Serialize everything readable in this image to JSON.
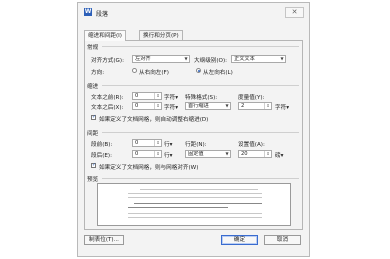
{
  "dialog": {
    "title": "段落",
    "app_icon": "W",
    "close_glyph": "✕",
    "tabs": [
      {
        "label": "缩进和间距(I)",
        "active": true
      },
      {
        "label": "换行和分页(P)",
        "active": false
      }
    ]
  },
  "general": {
    "heading": "常规",
    "alignment_label": "对齐方式(G):",
    "alignment_value": "左对齐",
    "outline_label": "大纲级别(O):",
    "outline_value": "正文文本",
    "direction_label": "方向:",
    "rtl_label": "从右向左(F)",
    "ltr_label": "从左向右(L)"
  },
  "indent": {
    "heading": "缩进",
    "before_label": "文本之前(R):",
    "before_value": "0",
    "before_unit": "字符▾",
    "after_label": "文本之后(X):",
    "after_value": "0",
    "after_unit": "字符▾",
    "special_label": "特殊格式(S):",
    "special_value": "首行缩进",
    "measure_label": "度量值(Y):",
    "measure_value": "2",
    "measure_unit": "字符▾",
    "auto_adjust_label": "如果定义了文档网格，则自动调整右缩进(D)"
  },
  "spacing": {
    "heading": "间距",
    "before_label": "段前(B):",
    "before_value": "0",
    "before_unit": "行▾",
    "after_label": "段后(E):",
    "after_value": "0",
    "after_unit": "行▾",
    "line_label": "行距(N):",
    "line_value": "固定值",
    "setting_label": "设置值(A):",
    "setting_value": "20",
    "setting_unit": "磅▾",
    "snap_grid_label": "如果定义了文档网格，则与网格对齐(W)"
  },
  "preview": {
    "heading": "预览"
  },
  "footer": {
    "tabs_button": "制表位(T)...",
    "ok_button": "确定",
    "cancel_button": "取消"
  },
  "colors": {
    "accent": "#2c5fb8",
    "dialog_bg": "#f3f3f3",
    "border": "#b5b5b5"
  }
}
